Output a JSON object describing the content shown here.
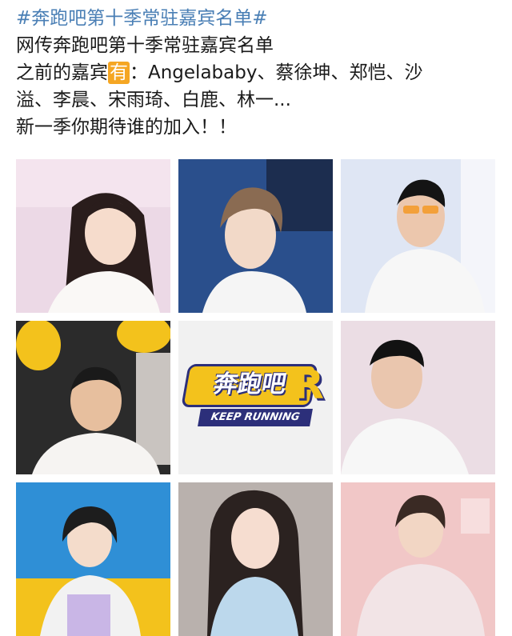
{
  "post": {
    "hashtag": "#奔跑吧第十季常驻嘉宾名单#",
    "line1": "网传奔跑吧第十季常驻嘉宾名单",
    "line2_prefix": "之前的嘉宾",
    "line2_highlight": "有",
    "line2_suffix": "：Angelababy、蔡徐坤、郑恺、沙",
    "line3": "溢、李晨、宋雨琦、白鹿、林一...",
    "line4": "新一季你期待谁的加入！！"
  },
  "logo": {
    "main": "奔跑吧",
    "badge": "R",
    "sub": "KEEP RUNNING"
  },
  "colors": {
    "hashtag": "#4a7fb5",
    "highlight": "#f5a623",
    "logo_yellow": "#f3c21c",
    "logo_navy": "#2c2f7a"
  }
}
